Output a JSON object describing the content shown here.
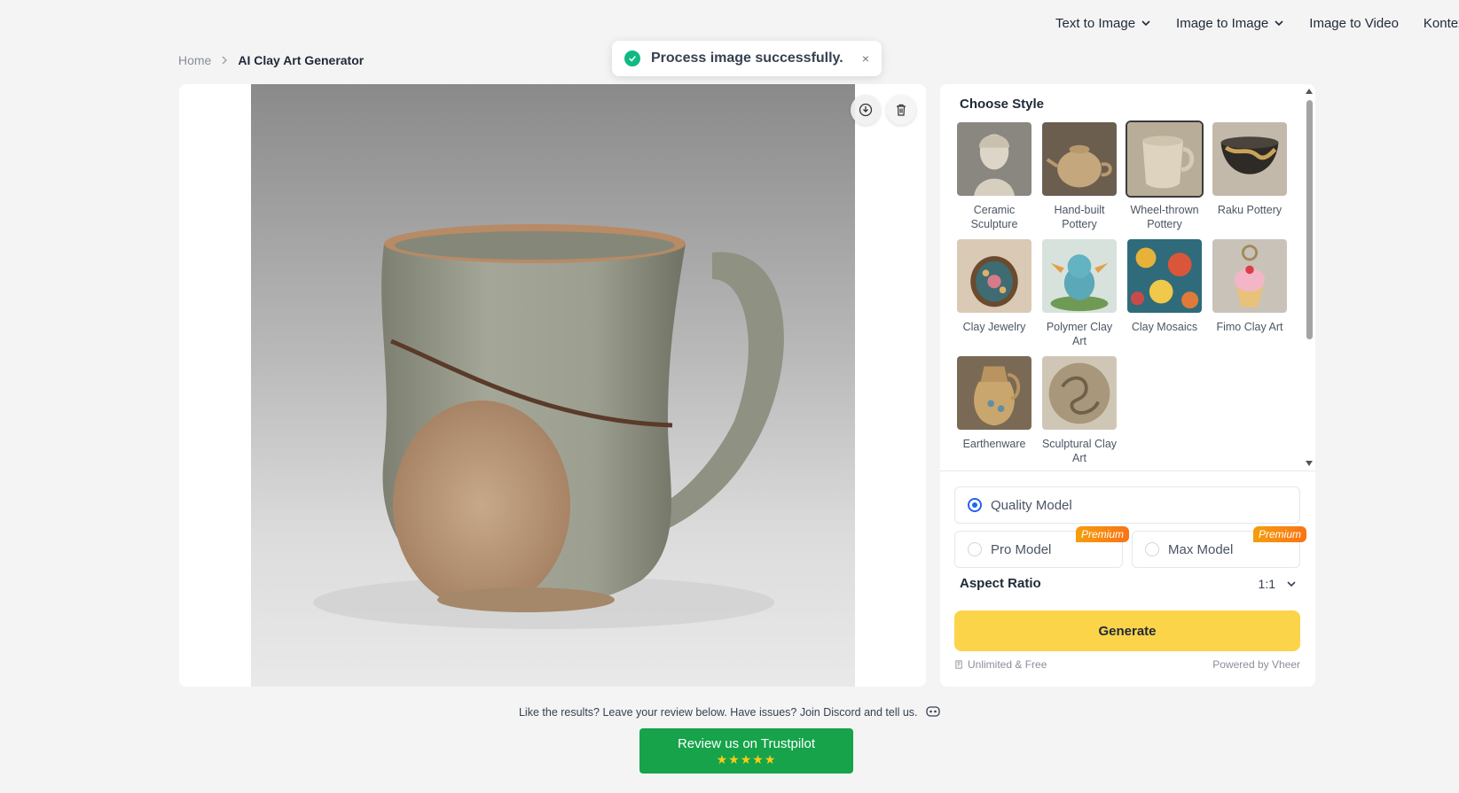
{
  "nav": {
    "items": [
      {
        "label": "Text to Image",
        "dropdown": true
      },
      {
        "label": "Image to Image",
        "dropdown": true
      },
      {
        "label": "Image to Video",
        "dropdown": false
      },
      {
        "label": "Kontex",
        "dropdown": false
      }
    ]
  },
  "breadcrumb": {
    "home": "Home",
    "current": "AI Clay Art Generator"
  },
  "toast": {
    "message": "Process image successfully.",
    "close": "×"
  },
  "image_actions": {
    "download_icon": "download-icon",
    "delete_icon": "trash-icon"
  },
  "style_panel": {
    "title": "Choose Style",
    "styles": [
      {
        "label": "Ceramic Sculpture",
        "selected": false
      },
      {
        "label": "Hand-built Pottery",
        "selected": false
      },
      {
        "label": "Wheel-thrown Pottery",
        "selected": true
      },
      {
        "label": "Raku Pottery",
        "selected": false
      },
      {
        "label": "Clay Jewelry",
        "selected": false
      },
      {
        "label": "Polymer Clay Art",
        "selected": false
      },
      {
        "label": "Clay Mosaics",
        "selected": false
      },
      {
        "label": "Fimo Clay Art",
        "selected": false
      },
      {
        "label": "Earthenware",
        "selected": false
      },
      {
        "label": "Sculptural Clay Art",
        "selected": false
      }
    ]
  },
  "models": {
    "quality": {
      "label": "Quality Model",
      "selected": true
    },
    "pro": {
      "label": "Pro Model",
      "badge": "Premium",
      "selected": false
    },
    "max": {
      "label": "Max Model",
      "badge": "Premium",
      "selected": false
    }
  },
  "aspect_ratio": {
    "label": "Aspect Ratio",
    "value": "1:1"
  },
  "generate": {
    "label": "Generate"
  },
  "footer": {
    "left": "Unlimited & Free",
    "right": "Powered by Vheer"
  },
  "review": {
    "text": "Like the results? Leave your review below. Have issues? Join Discord and tell us.",
    "button": "Review us on Trustpilot",
    "stars": "★★★★★"
  },
  "colors": {
    "accent_yellow": "#fbd44a",
    "trustpilot_green": "#16a34a",
    "success": "#10b981",
    "radio_blue": "#2563eb"
  }
}
